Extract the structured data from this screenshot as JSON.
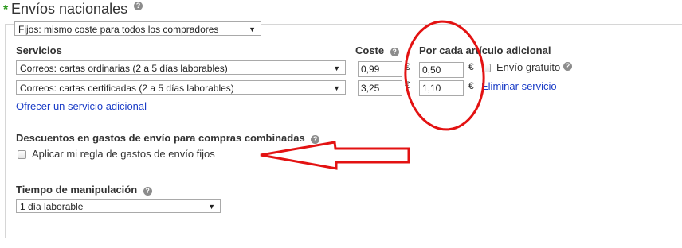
{
  "header": {
    "required_mark": "*",
    "title": "Envíos nacionales",
    "help_glyph": "?"
  },
  "shipping_type": {
    "selected": "Fijos: mismo coste para todos los compradores",
    "arrow": "▼"
  },
  "columns": {
    "services": "Servicios",
    "cost": "Coste",
    "additional": "Por cada artículo adicional"
  },
  "services": [
    {
      "selected": "Correos: cartas ordinarias (2 a 5 días laborables)",
      "cost": "0,99",
      "currency": "€",
      "additional_cost": "0,50",
      "additional_currency": "€",
      "extra_label": "Envío gratuito"
    },
    {
      "selected": "Correos: cartas certificadas (2 a 5 días laborables)",
      "cost": "3,25",
      "currency": "€",
      "additional_cost": "1,10",
      "additional_currency": "€",
      "extra_label": "Eliminar servicio"
    }
  ],
  "add_service_link": "Ofrecer un servicio adicional",
  "discounts": {
    "heading": "Descuentos en gastos de envío para compras combinadas",
    "checkbox_label": "Aplicar mi regla de gastos de envío fijos",
    "checked": false
  },
  "handling": {
    "heading": "Tiempo de manipulación",
    "selected": "1 día laborable"
  },
  "colors": {
    "required_mark": "#2e9a1f",
    "link": "#1a3cc7",
    "annotation": "#e31212"
  },
  "annotations": {
    "circle_icon": "red-ellipse-annotation",
    "arrow_icon": "red-arrow-annotation"
  }
}
